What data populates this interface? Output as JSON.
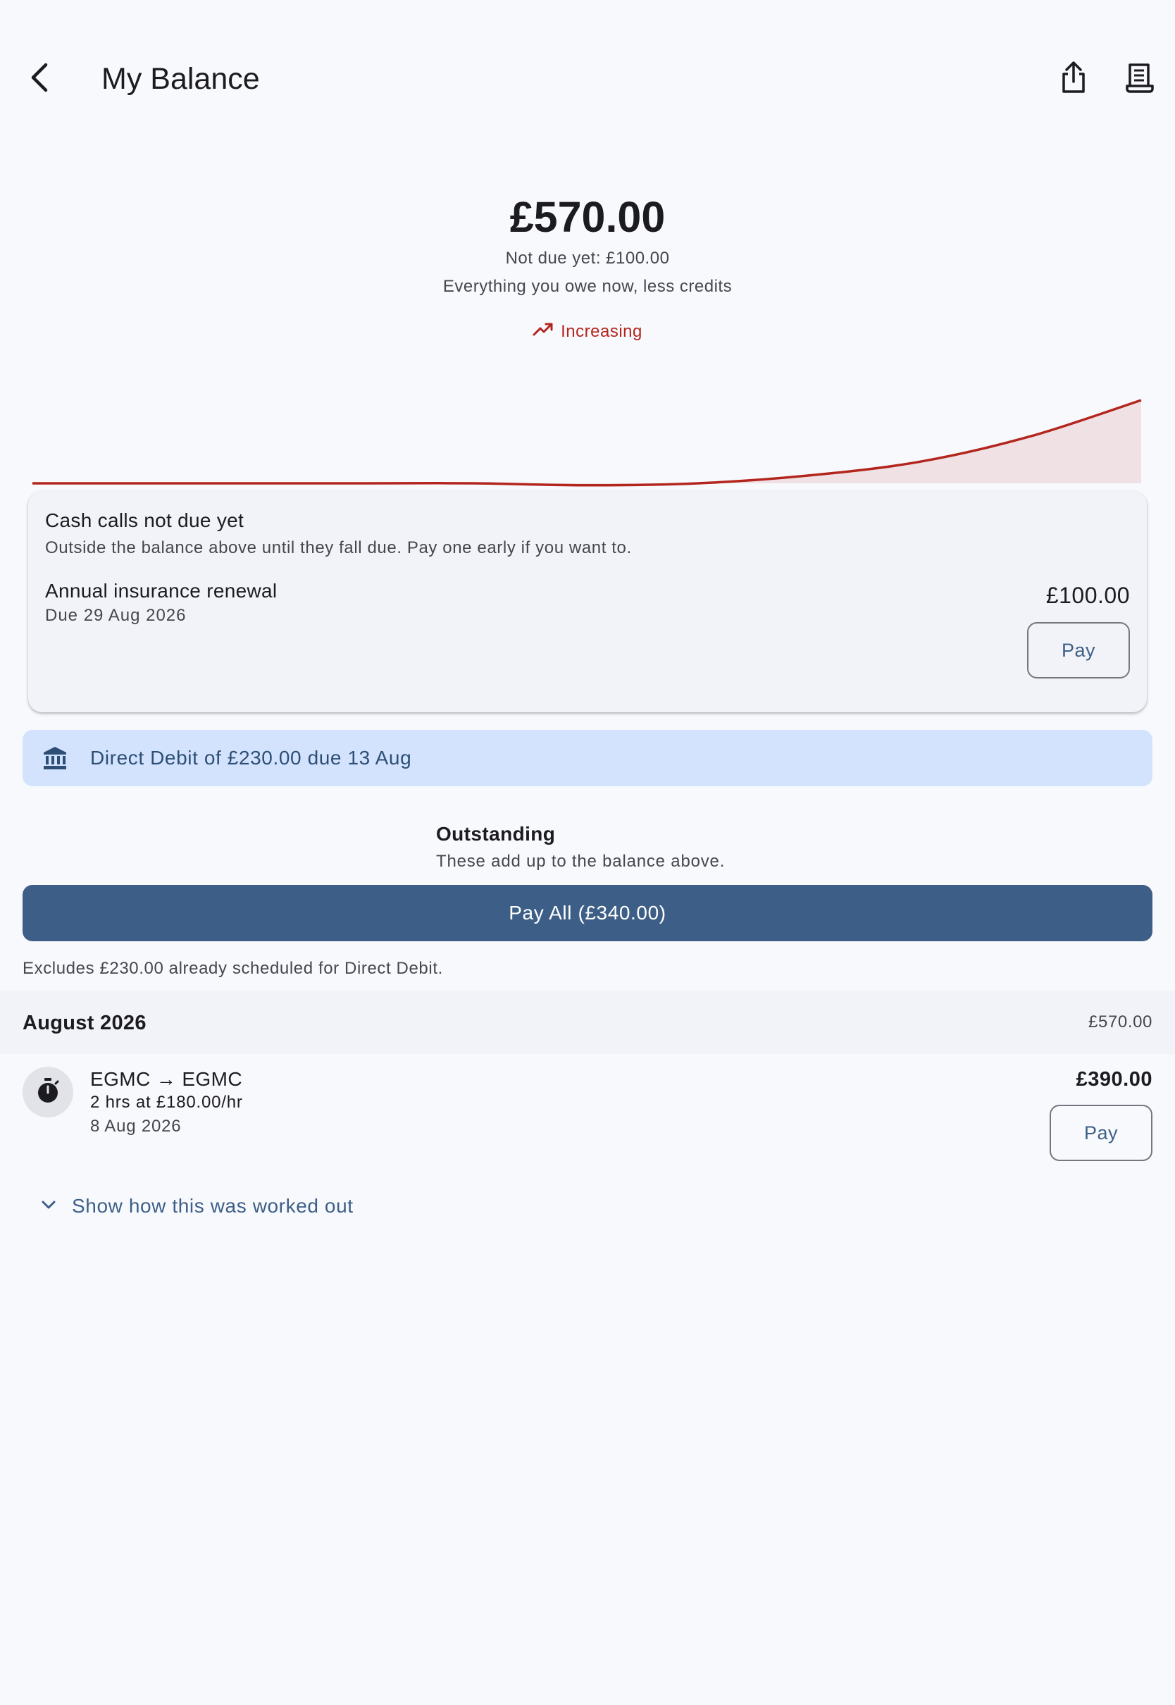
{
  "header": {
    "title": "My Balance",
    "back_icon": "arrow-back-icon",
    "share_icon": "share-icon",
    "statement_icon": "receipt-icon"
  },
  "balance": {
    "amount": "£570.00",
    "not_due": "Not due yet: £100.00",
    "description": "Everything you owe now, less credits",
    "trend_label": "Increasing",
    "trend_icon": "trending-up-icon",
    "trend_color": "#b3261e"
  },
  "chart_data": {
    "type": "area",
    "x": [
      0,
      1,
      2,
      3,
      4,
      5,
      6,
      7,
      8,
      9,
      10
    ],
    "values": [
      0,
      0,
      0,
      0,
      0,
      -2,
      0,
      8,
      22,
      48,
      85
    ],
    "xlabel": "",
    "ylabel": "",
    "grid": false,
    "line_color": "#b3261e",
    "fill_color": "#f0e1e5"
  },
  "cash_calls": {
    "title": "Cash calls not due yet",
    "subtitle": "Outside the balance above until they fall due. Pay one early if you want to.",
    "items": [
      {
        "name": "Annual insurance renewal",
        "due": "Due 29 Aug 2026",
        "amount": "£100.00",
        "pay_label": "Pay"
      }
    ]
  },
  "direct_debit": {
    "icon": "bank-icon",
    "text": "Direct Debit of £230.00 due 13 Aug"
  },
  "outstanding": {
    "title": "Outstanding",
    "subtitle": "These add up to the balance above.",
    "pay_all_label": "Pay All (£340.00)",
    "excludes_note": "Excludes £230.00 already scheduled for Direct Debit."
  },
  "months": [
    {
      "label": "August 2026",
      "total": "£570.00",
      "items": [
        {
          "icon": "timer-icon",
          "route": "EGMC → EGMC",
          "rate": "2 hrs at £180.00/hr",
          "date": "8 Aug 2026",
          "amount": "£390.00",
          "pay_label": "Pay"
        }
      ]
    }
  ],
  "expand": {
    "icon": "chevron-down-icon",
    "label": "Show how this was worked out"
  },
  "colors": {
    "background": "#f8f9fd",
    "primary": "#3d5f87",
    "banner": "#d3e3fd",
    "negative": "#b3261e"
  }
}
